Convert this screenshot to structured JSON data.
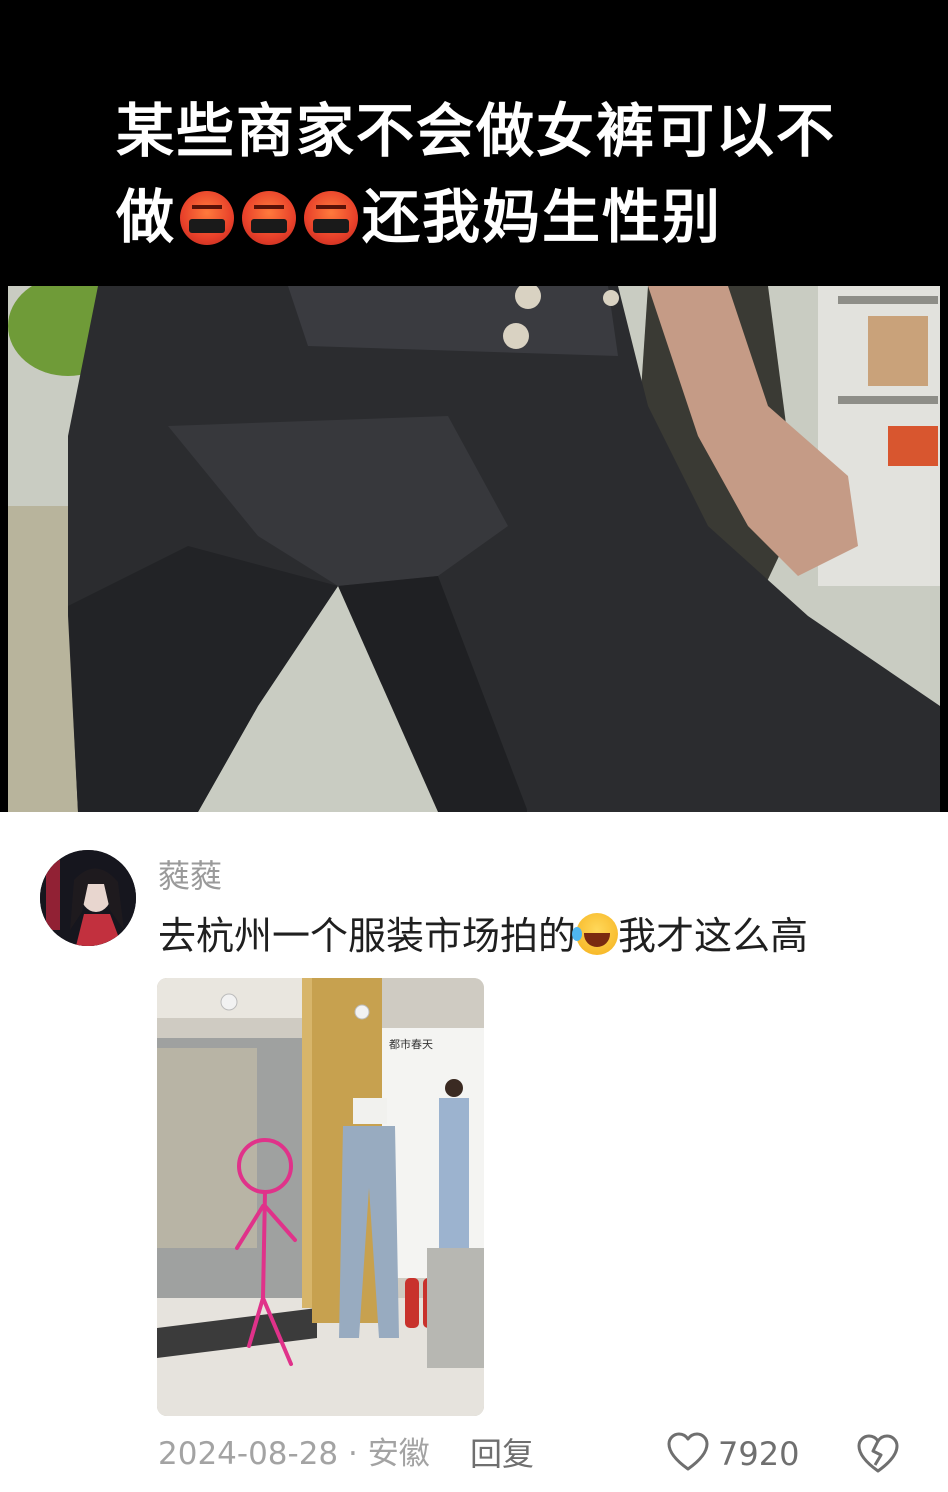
{
  "video": {
    "caption_line1": "某些商家不会做女裤可以不",
    "caption_line2_start": "做",
    "caption_line2_end": "还我妈生性别",
    "emoji": "angry-swearing-face"
  },
  "comment": {
    "username": "蕤蕤",
    "text_before_emoji": "去杭州一个服装市场拍的",
    "emoji": "rolling-on-floor-laughing",
    "text_after_emoji": "我才这么高",
    "image": {
      "sign_text": "都市春天"
    },
    "date": "2024-08-28",
    "separator": "·",
    "location": "安徽",
    "reply_label": "回复",
    "like_count": "7920"
  },
  "colors": {
    "caption_text": "#ffffff",
    "meta_gray": "#a3a3a3",
    "action_gray": "#6f6f6f",
    "comment_text": "#1f1f1f"
  }
}
